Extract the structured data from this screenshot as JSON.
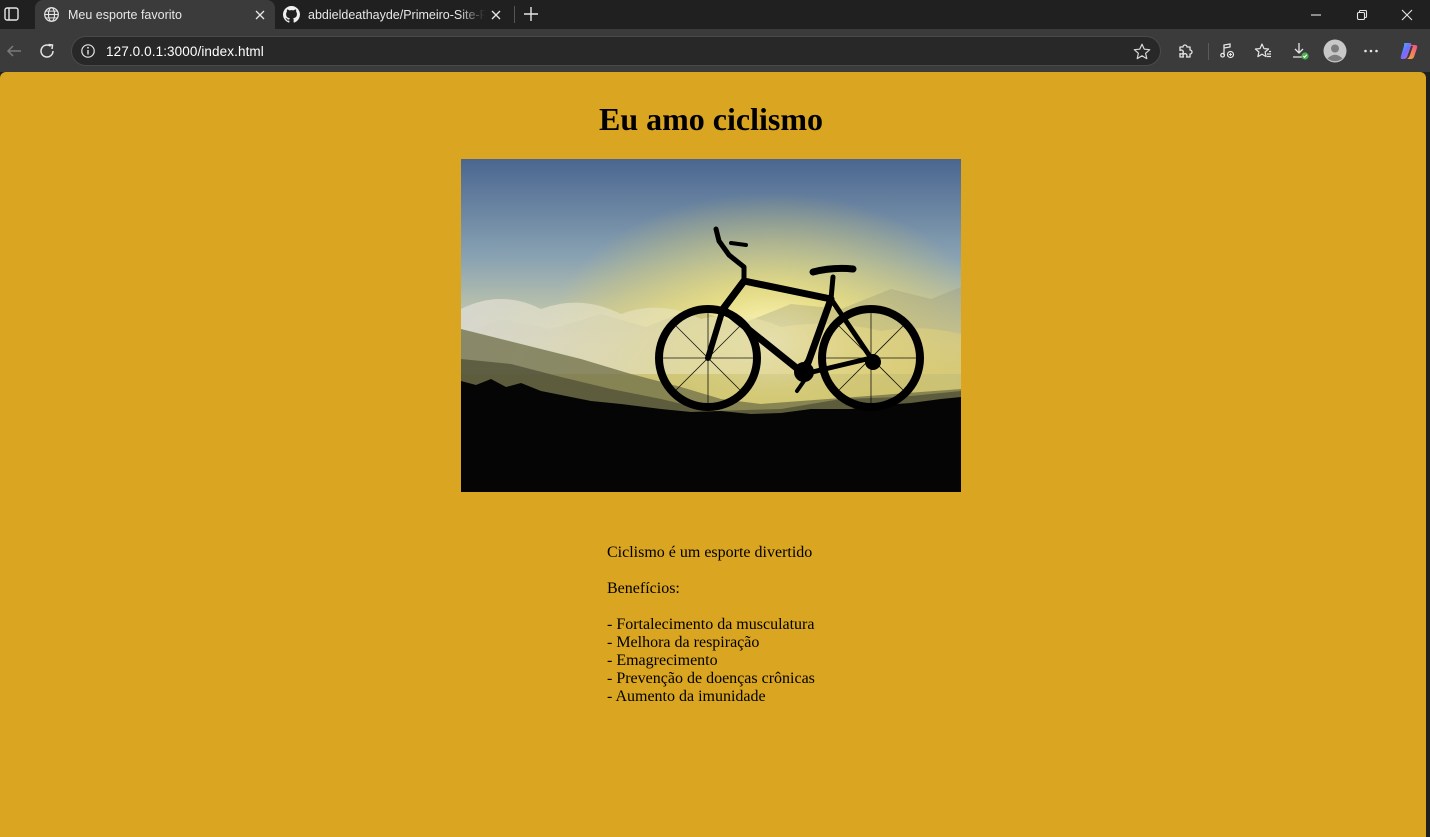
{
  "browser": {
    "tabs": [
      {
        "title": "Meu esporte favorito",
        "icon": "globe-icon",
        "active": true
      },
      {
        "title": "abdieldeathayde/Primeiro-Site-Re",
        "icon": "github-icon",
        "active": false
      }
    ],
    "address": {
      "url": "127.0.0.1:3000/index.html"
    }
  },
  "page": {
    "title": "Eu amo ciclismo",
    "image": {
      "alt": "bicicleta ao pôr do sol",
      "subject": "bicycle silhouette at sunset over mountains"
    },
    "intro": "Ciclismo é um esporte divertido",
    "benefits_heading": "Benefícios:",
    "benefits": [
      "- Fortalecimento da musculatura",
      "- Melhora da respiração",
      "- Emagrecimento",
      "- Prevenção de doenças crônicas",
      "- Aumento da imunidade"
    ]
  },
  "colors": {
    "page_background": "#daa520",
    "browser_chrome": "#202020",
    "toolbar": "#3b3b3b"
  }
}
